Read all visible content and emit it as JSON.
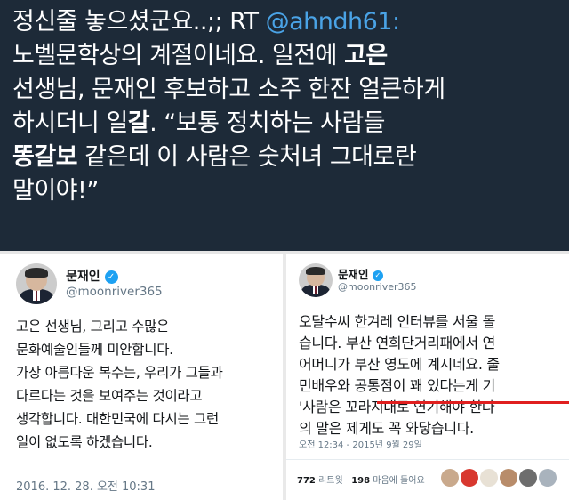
{
  "top_tweet": {
    "line1_a": "정신줄 놓으셨군요..;; RT ",
    "line1_handle": "@ahndh61:",
    "line2_a": "노벨문학상의 계절이네요. 일전에 ",
    "line2_b": "고은",
    "line3": "선생님, 문재인 후보하고 소주 한잔 얼큰하게",
    "line4_a": "하시더니 일",
    "line4_b": "갈",
    "line4_c": ". “보통 정치하는 사람들",
    "line5_a": "똥갈보",
    "line5_b": " 같은데 이 사람은 숫처녀 그대로란",
    "line6": "말이야!”"
  },
  "left_tweet": {
    "name": "문재인",
    "verified": "✓",
    "handle": "@moonriver365",
    "lines": [
      "고은 선생님, 그리고 수많은",
      "문화예술인들께 미안합니다.",
      "가장 아름다운 복수는, 우리가 그들과",
      "다르다는 것을 보여주는 것이라고",
      "생각합니다. 대한민국에 다시는 그런",
      "일이 없도록 하겠습니다."
    ],
    "timestamp": "2016. 12. 28. 오전 10:31"
  },
  "right_tweet": {
    "name": "문재인",
    "verified": "✓",
    "handle": "@moonriver365",
    "lines": [
      "오달수씨 한겨레 인터뷰를 서울 돌",
      "습니다. 부산 연희단거리패에서 연",
      "어머니가 부산 영도에 계시네요. 줄",
      "민배우와 공통점이 꽤 있다는게 기",
      "'사람은 꼬라지대로 연기해야 한다",
      "의 말은 제게도 꼭 와닿습니다."
    ],
    "timestamp": "오전 12:34 - 2015년 9월 29일",
    "retweets_count": "772",
    "retweets_label": "리트윗",
    "likes_count": "198",
    "likes_label": "마음에 들어요"
  },
  "colors": {
    "top_bg": "#1d2a38",
    "handle_blue": "#4aa3e6",
    "verified_blue": "#1da1f2",
    "underline_red": "#e01f1f"
  }
}
